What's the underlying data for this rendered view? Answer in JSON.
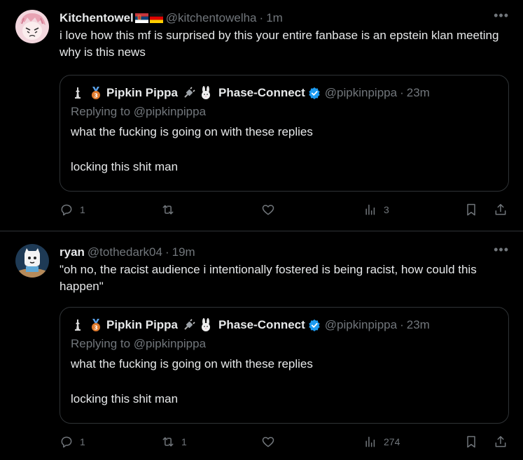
{
  "tweets": [
    {
      "name": "Kitchentowel",
      "handle": "@kitchentowelha",
      "time": "1m",
      "text": "i love how this mf is surprised by this your entire fanbase is an epstein klan meeting why is this news",
      "quote": {
        "name": "Pipkin Pippa",
        "name2": "Phase-Connect",
        "handle": "@pipkinpippa",
        "time": "23m",
        "replying": "Replying to @pipkinpippa",
        "line1": "what the fucking is going on with these replies",
        "line2": "locking this shit man"
      },
      "actions": {
        "replies": "1",
        "reposts": "",
        "likes": "",
        "views": "3"
      }
    },
    {
      "name": "ryan",
      "handle": "@tothedark04",
      "time": "19m",
      "text": "\"oh no, the racist audience i intentionally fostered is being racist, how could this happen\"",
      "quote": {
        "name": "Pipkin Pippa",
        "name2": "Phase-Connect",
        "handle": "@pipkinpippa",
        "time": "23m",
        "replying": "Replying to @pipkinpippa",
        "line1": "what the fucking is going on with these replies",
        "line2": "locking this shit man"
      },
      "actions": {
        "replies": "1",
        "reposts": "1",
        "likes": "",
        "views": "274"
      }
    }
  ],
  "separator": "·",
  "more_glyph": "•••",
  "colors": {
    "background": "#000000",
    "text": "#e7e9ea",
    "muted": "#71767b",
    "border": "#2f3336",
    "verified": "#1d9bf0"
  }
}
